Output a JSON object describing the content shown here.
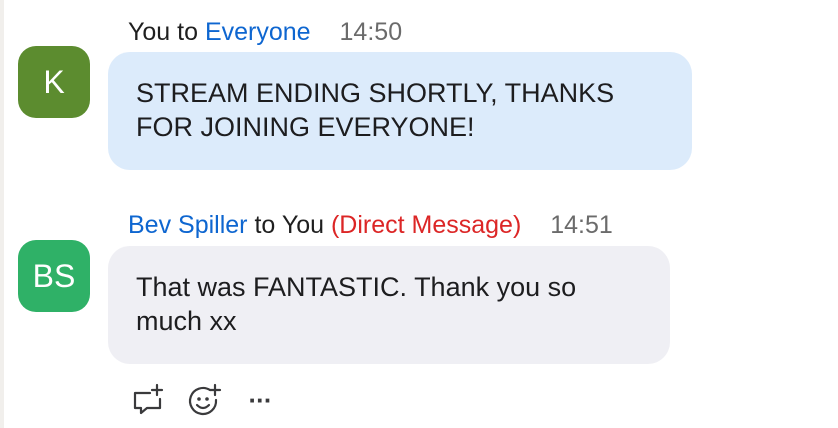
{
  "messages": [
    {
      "avatar_initials": "K",
      "avatar_color": "#5c8c2f",
      "sender": "You",
      "to_word": "to",
      "recipient": "Everyone",
      "tag": "",
      "time": "14:50",
      "text_line1": "STREAM ENDING SHORTLY, THANKS",
      "text_line2": "FOR JOINING EVERYONE!"
    },
    {
      "avatar_initials": "BS",
      "avatar_color": "#2fb167",
      "sender": "Bev Spiller",
      "to_word": "to",
      "recipient": "You",
      "tag": "(Direct Message)",
      "time": "14:51",
      "text_line1": "That was FANTASTIC. Thank you so",
      "text_line2": "much xx"
    }
  ],
  "actions": {
    "reply_icon": "comment-plus-icon",
    "react_icon": "emoji-plus-icon",
    "more_label": "···"
  },
  "colors": {
    "link": "#0e66d0",
    "direct_message": "#dc2626",
    "my_bubble": "#dcebfb",
    "their_bubble": "#efeff4"
  }
}
